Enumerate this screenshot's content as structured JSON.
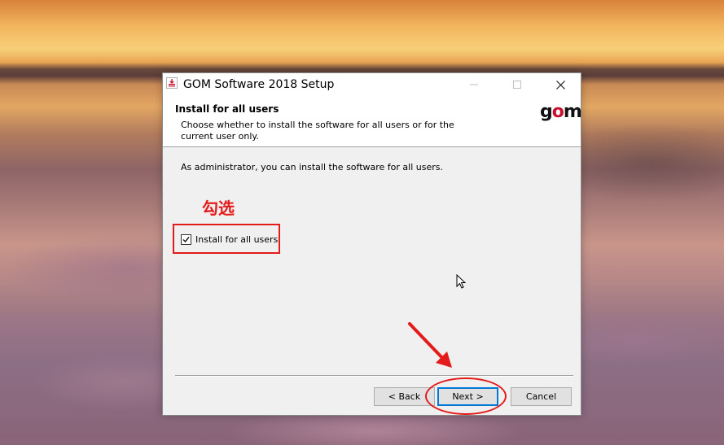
{
  "window": {
    "title": "GOM Software 2018 Setup",
    "app_icon": "installer-icon",
    "controls": [
      "minimize-icon",
      "maximize-icon",
      "close-icon"
    ]
  },
  "header": {
    "title": "Install for all users",
    "subtitle": "Choose whether to install the software for all users or for the current user only.",
    "logo_prefix": "g",
    "logo_o": "o",
    "logo_suffix": "m"
  },
  "main": {
    "description": "As administrator, you can install the software for all users.",
    "annotation_label": "勾选",
    "checkbox": {
      "label": "Install for all users",
      "checked": true
    }
  },
  "footer": {
    "back_label": "< Back",
    "next_label": "Next >",
    "cancel_label": "Cancel"
  },
  "colors": {
    "annotation_red": "#e31b1b",
    "logo_red": "#c8102e",
    "focus_blue": "#0078d7"
  }
}
